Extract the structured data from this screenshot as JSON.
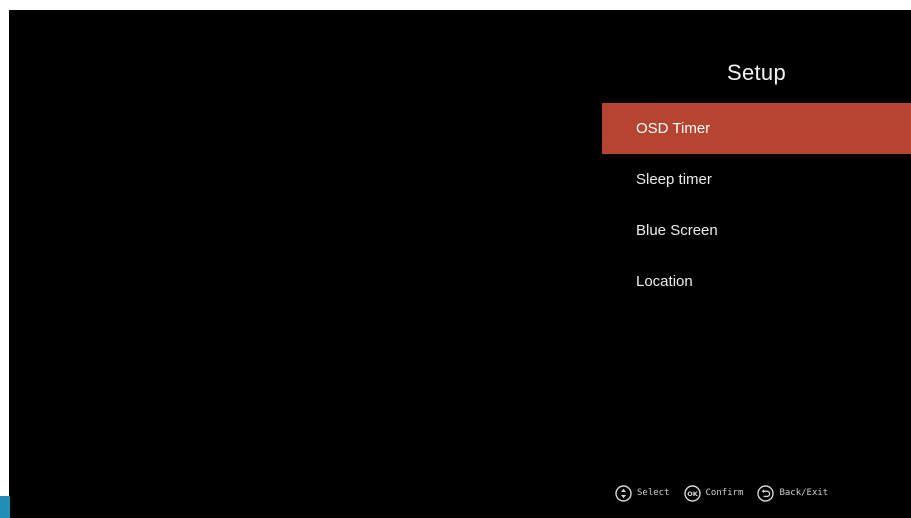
{
  "menu": {
    "title": "Setup",
    "items": [
      {
        "label": "OSD Timer",
        "selected": true
      },
      {
        "label": "Sleep timer",
        "selected": false
      },
      {
        "label": "Blue Screen",
        "selected": false
      },
      {
        "label": "Location",
        "selected": false
      }
    ],
    "accent_color": "#b54431"
  },
  "hints": [
    {
      "icon": "updown-icon",
      "label": "Select"
    },
    {
      "icon": "ok-icon",
      "label": "Confirm"
    },
    {
      "icon": "back-icon",
      "label": "Back/Exit"
    }
  ]
}
